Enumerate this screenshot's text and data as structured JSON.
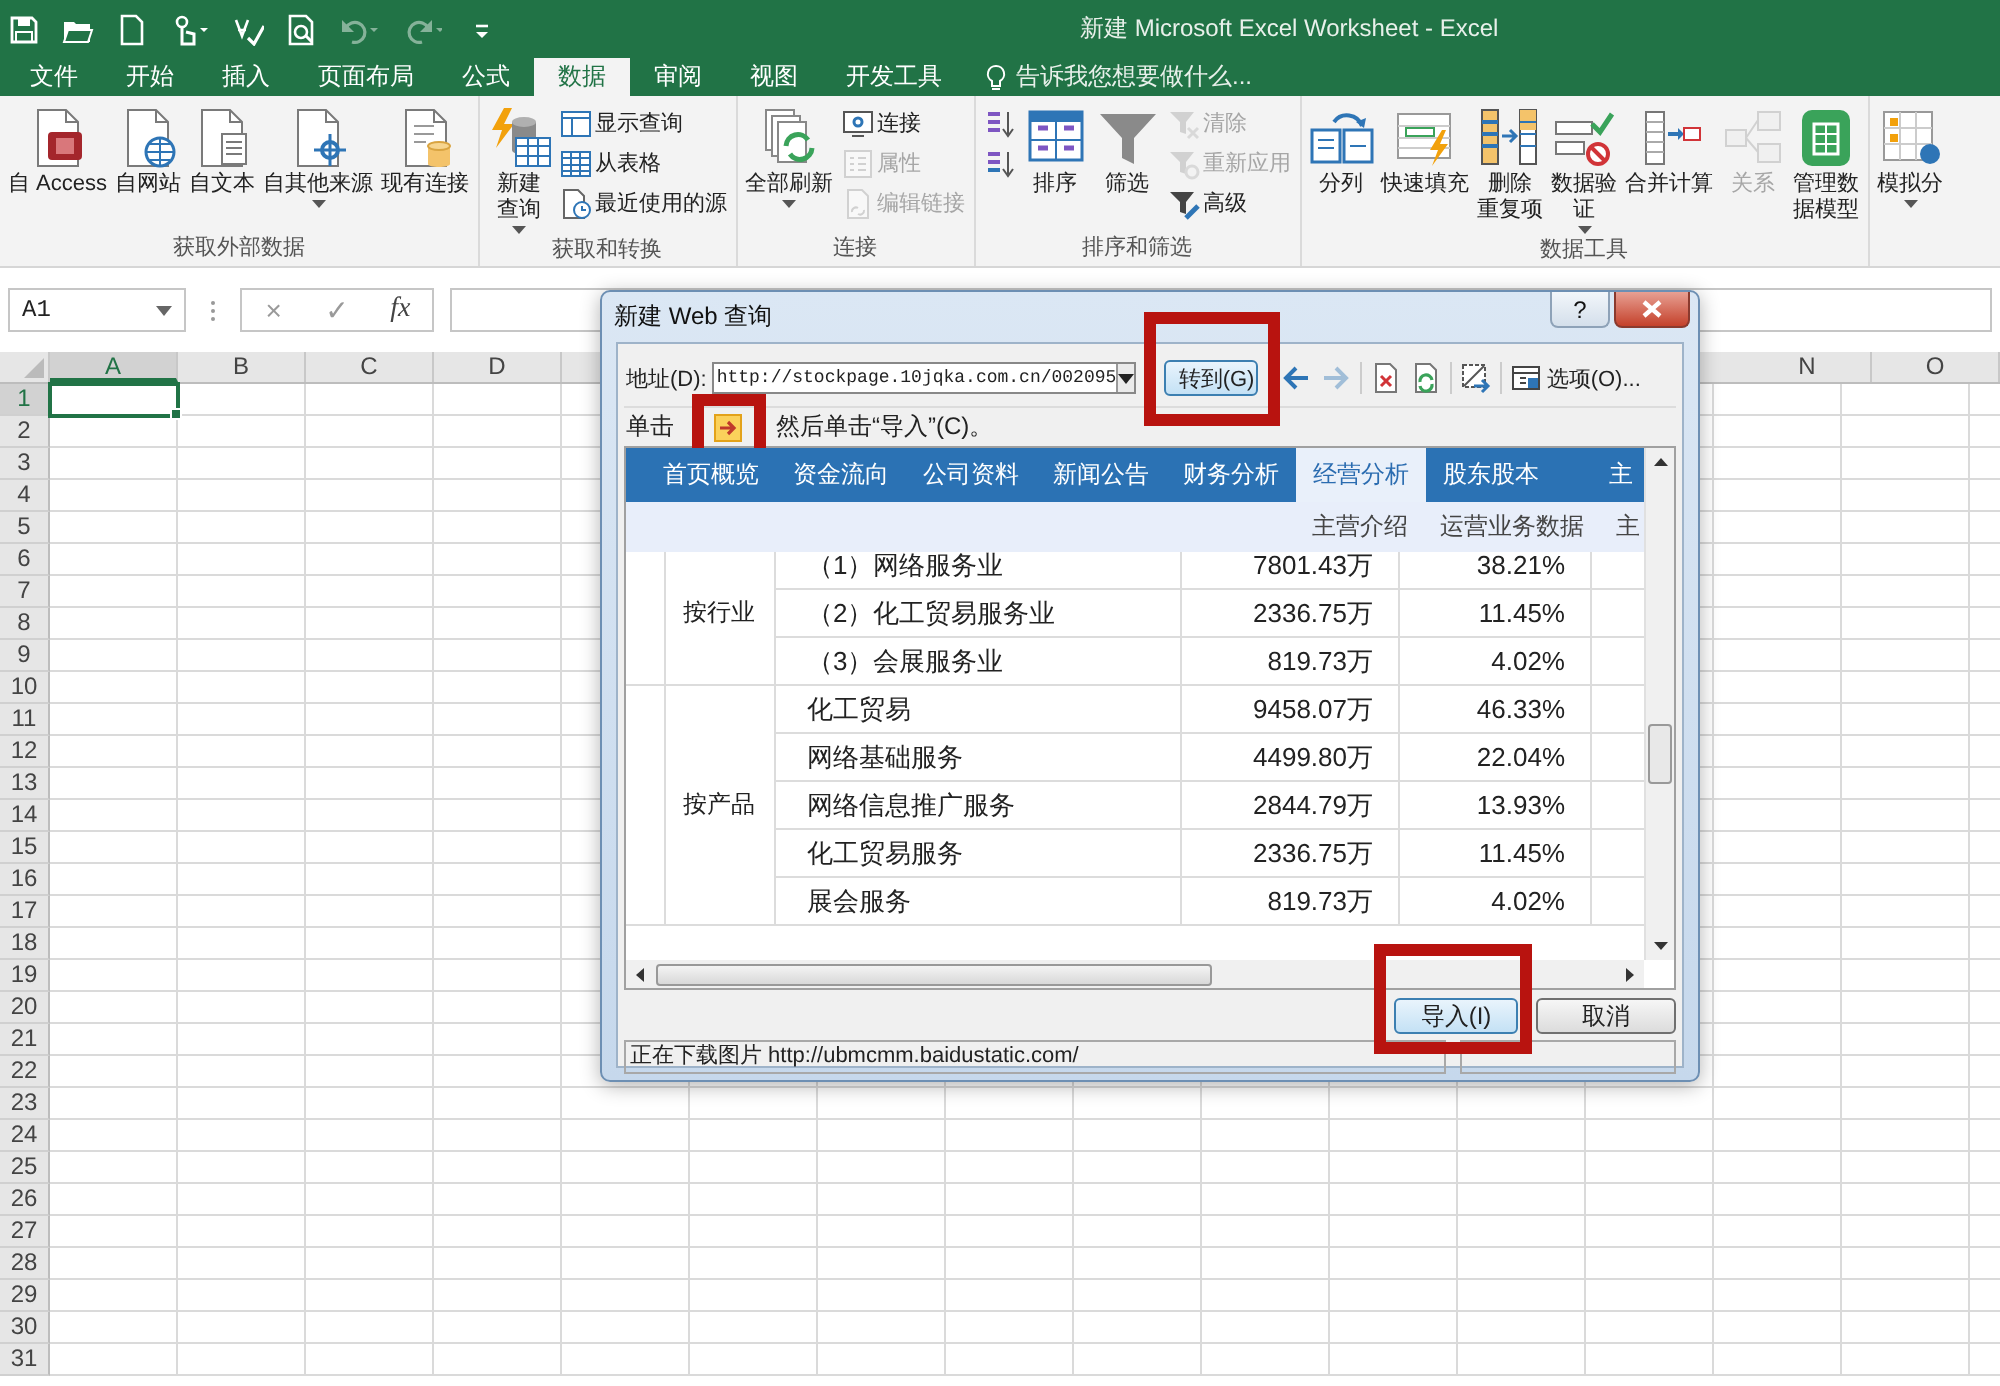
{
  "window": {
    "title": "新建 Microsoft Excel Worksheet - Excel"
  },
  "quick_access": [
    {
      "kind": "save",
      "disabled": false
    },
    {
      "kind": "open",
      "disabled": false
    },
    {
      "kind": "new",
      "disabled": false
    },
    {
      "kind": "touch",
      "disabled": false
    },
    {
      "kind": "spell",
      "disabled": false
    },
    {
      "kind": "preview",
      "disabled": false
    },
    {
      "kind": "undo",
      "disabled": true
    },
    {
      "kind": "redo",
      "disabled": true
    },
    {
      "kind": "customize",
      "disabled": false
    }
  ],
  "tabs": [
    {
      "label": "文件",
      "selected": false
    },
    {
      "label": "开始",
      "selected": false
    },
    {
      "label": "插入",
      "selected": false
    },
    {
      "label": "页面布局",
      "selected": false
    },
    {
      "label": "公式",
      "selected": false
    },
    {
      "label": "数据",
      "selected": true
    },
    {
      "label": "审阅",
      "selected": false
    },
    {
      "label": "视图",
      "selected": false
    },
    {
      "label": "开发工具",
      "selected": false
    }
  ],
  "tell_me": {
    "text": "告诉我您想要做什么..."
  },
  "ribbon": {
    "groups": [
      {
        "title": "获取外部数据",
        "items": [
          {
            "kind": "large",
            "lines": [
              "自 Access"
            ],
            "dropdown": false,
            "disabled": false
          },
          {
            "kind": "large",
            "lines": [
              "自网站"
            ],
            "dropdown": false,
            "disabled": false
          },
          {
            "kind": "large",
            "lines": [
              "自文本"
            ],
            "dropdown": false,
            "disabled": false
          },
          {
            "kind": "large",
            "lines": [
              "自其他来源"
            ],
            "dropdown": true,
            "disabled": false
          },
          {
            "kind": "large",
            "lines": [
              "现有连接"
            ],
            "dropdown": false,
            "disabled": false
          }
        ]
      },
      {
        "title": "获取和转换",
        "items": [
          {
            "kind": "large",
            "lines": [
              "新建",
              "查询"
            ],
            "dropdown": true,
            "disabled": false
          },
          {
            "kind": "stack",
            "buttons": [
              {
                "label": "显示查询",
                "disabled": false
              },
              {
                "label": "从表格",
                "disabled": false
              },
              {
                "label": "最近使用的源",
                "disabled": false
              }
            ]
          }
        ]
      },
      {
        "title": "连接",
        "items": [
          {
            "kind": "large",
            "lines": [
              "全部刷新"
            ],
            "dropdown": true,
            "disabled": false
          },
          {
            "kind": "stack",
            "buttons": [
              {
                "label": "连接",
                "disabled": false
              },
              {
                "label": "属性",
                "disabled": true
              },
              {
                "label": "编辑链接",
                "disabled": true
              }
            ]
          }
        ]
      },
      {
        "title": "排序和筛选",
        "items": [
          {
            "kind": "stack",
            "buttons": [
              {
                "disabled": false
              },
              {
                "disabled": false
              }
            ]
          },
          {
            "kind": "large",
            "lines": [
              "排序"
            ],
            "dropdown": false,
            "disabled": false
          },
          {
            "kind": "large",
            "lines": [
              "筛选"
            ],
            "dropdown": false,
            "disabled": false
          },
          {
            "kind": "stack",
            "buttons": [
              {
                "label": "清除",
                "disabled": true
              },
              {
                "label": "重新应用",
                "disabled": true
              },
              {
                "label": "高级",
                "disabled": false
              }
            ]
          }
        ]
      },
      {
        "title": "数据工具",
        "items": [
          {
            "kind": "large",
            "lines": [
              "分列"
            ],
            "dropdown": false,
            "disabled": false
          },
          {
            "kind": "large",
            "lines": [
              "快速填充"
            ],
            "dropdown": false,
            "disabled": false
          },
          {
            "kind": "large",
            "lines": [
              "删除",
              "重复项"
            ],
            "dropdown": false,
            "disabled": false
          },
          {
            "kind": "large",
            "lines": [
              "数据验",
              "证"
            ],
            "dropdown": true,
            "disabled": false
          },
          {
            "kind": "large",
            "lines": [
              "合并计算"
            ],
            "dropdown": false,
            "disabled": false
          },
          {
            "kind": "large",
            "lines": [
              "关系"
            ],
            "dropdown": false,
            "disabled": true
          },
          {
            "kind": "large",
            "lines": [
              "管理数",
              "据模型"
            ],
            "dropdown": false,
            "disabled": false
          }
        ]
      },
      {
        "items": [
          {
            "kind": "large",
            "lines": [
              "模拟分"
            ],
            "dropdown": true,
            "disabled": false
          }
        ]
      }
    ]
  },
  "formula_bar": {
    "name_box": "A1",
    "buttons": [
      "×",
      "✓",
      "fx"
    ]
  },
  "sheet": {
    "columns_left": [
      {
        "label": "A",
        "selected": true
      },
      {
        "label": "B",
        "selected": false
      },
      {
        "label": "C",
        "selected": false
      },
      {
        "label": "D",
        "selected": false
      }
    ],
    "columns_right": [
      {
        "label": "N",
        "selected": false
      },
      {
        "label": "O",
        "selected": false
      }
    ],
    "rows": [
      {
        "label": "1",
        "selected": true
      },
      {
        "label": "2",
        "selected": false
      },
      {
        "label": "3",
        "selected": false
      },
      {
        "label": "4",
        "selected": false
      },
      {
        "label": "5",
        "selected": false
      },
      {
        "label": "6",
        "selected": false
      },
      {
        "label": "7",
        "selected": false
      },
      {
        "label": "8",
        "selected": false
      },
      {
        "label": "9",
        "selected": false
      },
      {
        "label": "10",
        "selected": false
      },
      {
        "label": "11",
        "selected": false
      },
      {
        "label": "12",
        "selected": false
      },
      {
        "label": "13",
        "selected": false
      },
      {
        "label": "14",
        "selected": false
      },
      {
        "label": "15",
        "selected": false
      },
      {
        "label": "16",
        "selected": false
      },
      {
        "label": "17",
        "selected": false
      },
      {
        "label": "18",
        "selected": false
      },
      {
        "label": "19",
        "selected": false
      },
      {
        "label": "20",
        "selected": false
      },
      {
        "label": "21",
        "selected": false
      },
      {
        "label": "22",
        "selected": false
      },
      {
        "label": "23",
        "selected": false
      },
      {
        "label": "24",
        "selected": false
      },
      {
        "label": "25",
        "selected": false
      },
      {
        "label": "26",
        "selected": false
      },
      {
        "label": "27",
        "selected": false
      },
      {
        "label": "28",
        "selected": false
      },
      {
        "label": "29",
        "selected": false
      },
      {
        "label": "30",
        "selected": false
      },
      {
        "label": "31",
        "selected": false
      }
    ]
  },
  "dialog": {
    "title": "新建 Web 查询",
    "help_button": "?",
    "address_label": "地址(D):",
    "address_value": "http://stockpage.10jqka.com.cn/002095",
    "go_button": {
      "label": "转到(G)",
      "highlighted": true
    },
    "toolbar": [
      {
        "kind": "back",
        "disabled": false
      },
      {
        "kind": "forward",
        "disabled": true
      },
      {
        "kind": "stop",
        "disabled": false
      },
      {
        "kind": "refresh",
        "disabled": false
      },
      {
        "kind": "hide_icons",
        "disabled": false
      }
    ],
    "options_button": {
      "label": "选项(O)..."
    },
    "hint_before": "单击",
    "hint_icon": {
      "highlighted": true
    },
    "hint_after": "然后单击“导入”(C)。",
    "web_page": {
      "nav": [
        {
          "label": "首页概览",
          "selected": false
        },
        {
          "label": "资金流向",
          "selected": false
        },
        {
          "label": "公司资料",
          "selected": false
        },
        {
          "label": "新闻公告",
          "selected": false
        },
        {
          "label": "财务分析",
          "selected": false
        },
        {
          "label": "经营分析",
          "selected": true
        },
        {
          "label": "股东股本",
          "selected": false
        },
        {
          "label": "主",
          "selected": false
        }
      ],
      "subnav": [
        "主营介绍",
        "运营业务数据",
        "主"
      ],
      "table": [
        {
          "group": "按行业",
          "rows": [
            {
              "name": "（1）网络服务业",
              "amount": "7801.43万",
              "share": "38.21%"
            },
            {
              "name": "（2）化工贸易服务业",
              "amount": "2336.75万",
              "share": "11.45%"
            },
            {
              "name": "（3）会展服务业",
              "amount": "819.73万",
              "share": "4.02%"
            }
          ]
        },
        {
          "group": "按产品",
          "rows": [
            {
              "name": "化工贸易",
              "amount": "9458.07万",
              "share": "46.33%"
            },
            {
              "name": "网络基础服务",
              "amount": "4499.80万",
              "share": "22.04%"
            },
            {
              "name": "网络信息推广服务",
              "amount": "2844.79万",
              "share": "13.93%"
            },
            {
              "name": "化工贸易服务",
              "amount": "2336.75万",
              "share": "11.45%"
            },
            {
              "name": "展会服务",
              "amount": "819.73万",
              "share": "4.02%"
            }
          ]
        }
      ]
    },
    "import_button": {
      "label": "导入(I)",
      "highlighted": true
    },
    "cancel_button": {
      "label": "取消"
    },
    "status": "正在下载图片 http://ubmcmm.baidustatic.com/"
  }
}
